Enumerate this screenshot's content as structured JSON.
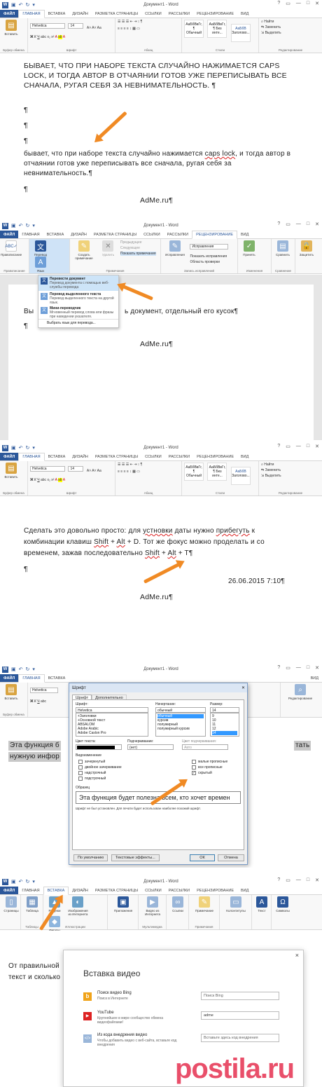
{
  "common": {
    "doc_title": "Документ1 - Word",
    "help": "?",
    "win_controls": [
      "▭",
      "—",
      "□",
      "✕"
    ],
    "tabs": [
      "ФАЙЛ",
      "ГЛАВНАЯ",
      "ВСТАВКА",
      "ДИЗАЙН",
      "РАЗМЕТКА СТРАНИЦЫ",
      "ССЫЛКИ",
      "РАССЫЛКИ",
      "РЕЦЕНЗИРОВАНИЕ",
      "ВИД"
    ],
    "ribbon": {
      "paste": "Вставить",
      "clipboard": "Буфер обмена",
      "font_name": "Helvetica",
      "font_size": "14",
      "font_group": "Шрифт",
      "paragraph": "Абзац",
      "styles": "Стили",
      "style1_sample": "АаБбВвГг,",
      "style1": "¶ Обычный",
      "style2_sample": "АаБбВвГг,",
      "style2": "¶ Без инте...",
      "style3_sample": "АаБбВ",
      "style3": "Заголово...",
      "find": "Найти",
      "replace": "Заменить",
      "select": "Выделить",
      "editing": "Редактирование"
    }
  },
  "panel1": {
    "upper": "БЫВАЕТ, ЧТО ПРИ НАБОРЕ ТЕКСТА СЛУЧАЙНО НАЖИМАЕТСЯ CAPS LOCK, И ТОГДА АВТОР В ОТЧАЯНИИ ГОТОВ УЖЕ ПЕРЕПИСЫВАТЬ ВСЕ СНАЧАЛА, РУГАЯ СЕБЯ ЗА НЕВНИМАТЕЛЬНОСТЬ. ¶",
    "pilcrow": "¶",
    "lower_pre": "бывает, что при наборе текста случайно нажимается ",
    "lower_err": "caps lock",
    "lower_post": ", и тогда автор в отчаянии готов уже переписывать все сначала, ругая себя за невнимательность.¶",
    "adme": "AdMe.ru¶"
  },
  "panel2": {
    "ribbon": {
      "spelling": "Правописание",
      "spelling_group": "Правописание",
      "translate": "Перевод",
      "language": "Язык",
      "new_comment": "Создать примечание",
      "delete": "Удалить",
      "prev": "Предыдущее",
      "next": "Следующее",
      "show_comments": "Показать примечания",
      "notes_group": "Примечания",
      "track": "Исправления",
      "markup_mode": "Исправления",
      "show_markup": "Показать исправления",
      "review_pane": "Область проверки",
      "tracking_group": "Запись исправлений",
      "accept": "Принять",
      "changes_group": "Изменения",
      "compare": "Сравнить",
      "compare_group": "Сравнение",
      "protect": "Защитить"
    },
    "menu": [
      {
        "title": "Перевести документ",
        "desc": "Перевод документа с помощью веб-службы перевода"
      },
      {
        "title": "Перевод выделенного текста",
        "desc": "Перевод выделенного текста на другой язык."
      },
      {
        "title": "Мини-переводчик",
        "desc": "Мгновенный перевод слова или фразы при наведении указателя."
      }
    ],
    "menu_footer": "Выбрать язык для перевода...",
    "body_left": "Вы",
    "body_right": "ь документ, отдельный его кусок¶",
    "pilcrow": "¶",
    "adme": "AdMe.ru¶"
  },
  "panel3": {
    "line1_pre": "Сделать это довольно просто: для ",
    "line1_err1": "устновки",
    "line1_mid": " даты нужно ",
    "line1_err2": "прибегуть",
    "line1_post": " к",
    "line2_pre": "комбинации клавиш ",
    "shift": "Shift",
    "plus": " + ",
    "alt": "Alt",
    "line2_post": " + D. Тот же фокус можно проделать и со",
    "line3_pre": "временем, зажав последовательно ",
    "line3_end": " + T¶",
    "pilcrow": "¶",
    "date": "26.06.2015 7:10¶",
    "adme": "AdMe.ru¶"
  },
  "panel4": {
    "dialog_title": "Шрифт",
    "tab1": "Шрифт",
    "tab2": "Дополнительно",
    "font_label": "Шрифт:",
    "font_value": "Helvetica",
    "fonts": [
      "+Заголовки",
      "+Основной текст",
      "ABSALOM",
      "Adobe Arabic",
      "Adobe Caslon Pro"
    ],
    "style_label": "Начертание:",
    "style_value": "обычный",
    "styles": [
      "обычный",
      "курсив",
      "полужирный",
      "полужирный курсив"
    ],
    "size_label": "Размер:",
    "size_value": "14",
    "sizes": [
      "9",
      "10",
      "11",
      "12",
      "14"
    ],
    "color_label": "Цвет текста:",
    "underline_label": "Подчеркивание:",
    "underline_value": "(нет)",
    "ucolor_label": "Цвет подчеркивания:",
    "ucolor_value": "Авто",
    "effects_label": "Видоизменение",
    "effects_left": [
      "зачеркнутый",
      "двойное зачеркивание",
      "надстрочный",
      "подстрочный"
    ],
    "effects_right": [
      "малые прописные",
      "все прописные",
      "скрытый"
    ],
    "sample_label": "Образец",
    "sample_text": "Эта функция будет полезна всем, кто хочет времен",
    "note": "Шрифт не был установлен. Для печати будет использован наиболее похожий шрифт.",
    "default_btn": "По умолчанию",
    "effects_btn": "Текстовые эффекты...",
    "ok": "ОК",
    "cancel": "Отмена",
    "bg_line1": "Эта функция б",
    "bg_line1_end": "тать",
    "bg_line2": "нужную инфор",
    "editing": "Редактирование"
  },
  "panel5": {
    "ribbon": {
      "pages": "Страницы",
      "table": "Таблица",
      "tables_group": "Таблицы",
      "pictures": "Рисунки",
      "online_pictures": "Изображения из Интернета",
      "shapes": "Фигуры",
      "illustrations": "Иллюстрации",
      "apps": "Приложения",
      "video": "Видео из Интернета",
      "media": "Мультимедиа",
      "links": "Ссылки",
      "comment": "Примечание",
      "notes": "Примечания",
      "header_footer": "Колонтитулы",
      "text": "Текст",
      "symbols": "Символы"
    },
    "dialog_title": "Вставка видео",
    "close": "×",
    "sources": [
      {
        "name": "Поиск видео Bing",
        "desc": "Поиск в Интернете",
        "field": "Поиск Bing"
      },
      {
        "name": "YouTube",
        "desc": "Крупнейшее в мире сообщество обмена видеофайлами!",
        "field": "adme"
      },
      {
        "name": "Из кода внедрения видео",
        "desc": "Чтобы добавить видео с веб-сайта, вставьте код внедрения",
        "field": "Вставьте здесь код внедрения"
      }
    ],
    "body_line1": "От правильной",
    "body_line2": "текст и сколько",
    "watermark": "postila.ru"
  }
}
